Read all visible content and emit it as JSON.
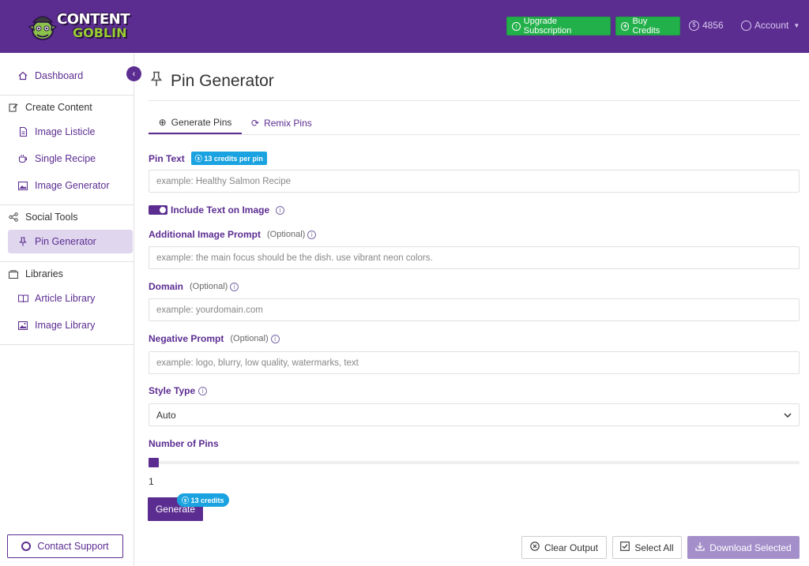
{
  "header": {
    "logo_line1": "CONTENT",
    "logo_line2": "GOBLIN",
    "upgrade_label": "Upgrade Subscription",
    "buy_credits_label": "Buy Credits",
    "credits_balance": "4856",
    "account_label": "Account"
  },
  "sidebar": {
    "dashboard": "Dashboard",
    "sections": [
      {
        "title": "Create Content",
        "items": [
          "Image Listicle",
          "Single Recipe",
          "Image Generator"
        ]
      },
      {
        "title": "Social Tools",
        "items": [
          "Pin Generator"
        ]
      },
      {
        "title": "Libraries",
        "items": [
          "Article Library",
          "Image Library"
        ]
      }
    ],
    "active_item": "Pin Generator",
    "support_label": "Contact Support"
  },
  "main": {
    "title": "Pin Generator",
    "tabs": [
      {
        "label": "Generate Pins",
        "active": true
      },
      {
        "label": "Remix Pins",
        "active": false
      }
    ],
    "pin_text": {
      "label": "Pin Text",
      "cost_badge": "13 credits per pin",
      "placeholder": "example: Healthy Salmon Recipe"
    },
    "include_text": {
      "label": "Include Text on Image",
      "enabled": true
    },
    "additional_prompt": {
      "label": "Additional Image Prompt",
      "optional": "(Optional)",
      "placeholder": "example: the main focus should be the dish. use vibrant neon colors."
    },
    "domain": {
      "label": "Domain",
      "optional": "(Optional)",
      "placeholder": "example: yourdomain.com"
    },
    "negative_prompt": {
      "label": "Negative Prompt",
      "optional": "(Optional)",
      "placeholder": "example: logo, blurry, low quality, watermarks, text"
    },
    "style_type": {
      "label": "Style Type",
      "value": "Auto"
    },
    "number_of_pins": {
      "label": "Number of Pins",
      "value": "1"
    },
    "generate": {
      "label": "Generate",
      "badge": "13 credits"
    },
    "actions": {
      "clear": "Clear Output",
      "select_all": "Select All",
      "download": "Download Selected"
    }
  },
  "colors": {
    "brand": "#5c2d91",
    "success": "#22b04a",
    "info": "#1aa3e0",
    "download_disabled": "#a58fca"
  }
}
